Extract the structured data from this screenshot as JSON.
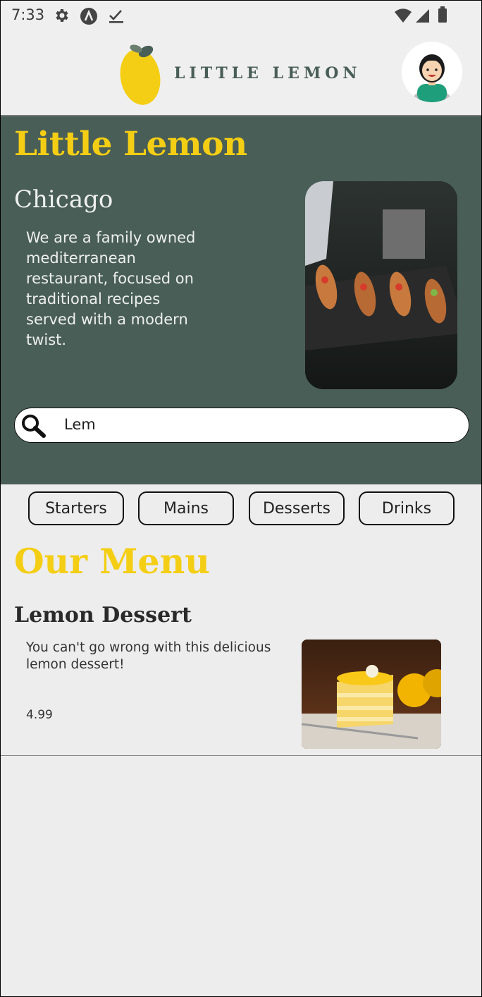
{
  "status_bar": {
    "time": "7:33",
    "left_icons": [
      "settings-icon",
      "app-a-icon",
      "download-done-icon"
    ],
    "right_icons": [
      "wifi-icon",
      "cell-signal-icon",
      "battery-icon"
    ]
  },
  "header": {
    "logo_text": "LITTLE LEMON",
    "avatar": "profile-avatar"
  },
  "hero": {
    "title": "Little Lemon",
    "city": "Chicago",
    "description": "We are a family owned mediterranean restaurant, focused on traditional recipes served with a modern twist.",
    "image": "food-platter-photo"
  },
  "search": {
    "value": "Lem",
    "icon": "search-icon"
  },
  "categories": [
    "Starters",
    "Mains",
    "Desserts",
    "Drinks"
  ],
  "menu": {
    "title": "Our Menu",
    "items": [
      {
        "name": "Lemon Dessert",
        "description": "You can't go wrong with this delicious lemon dessert!",
        "price": "4.99",
        "image": "lemon-cake-photo"
      }
    ]
  },
  "colors": {
    "primary_green": "#495e57",
    "primary_yellow": "#f4ce14",
    "background": "#ededed"
  }
}
